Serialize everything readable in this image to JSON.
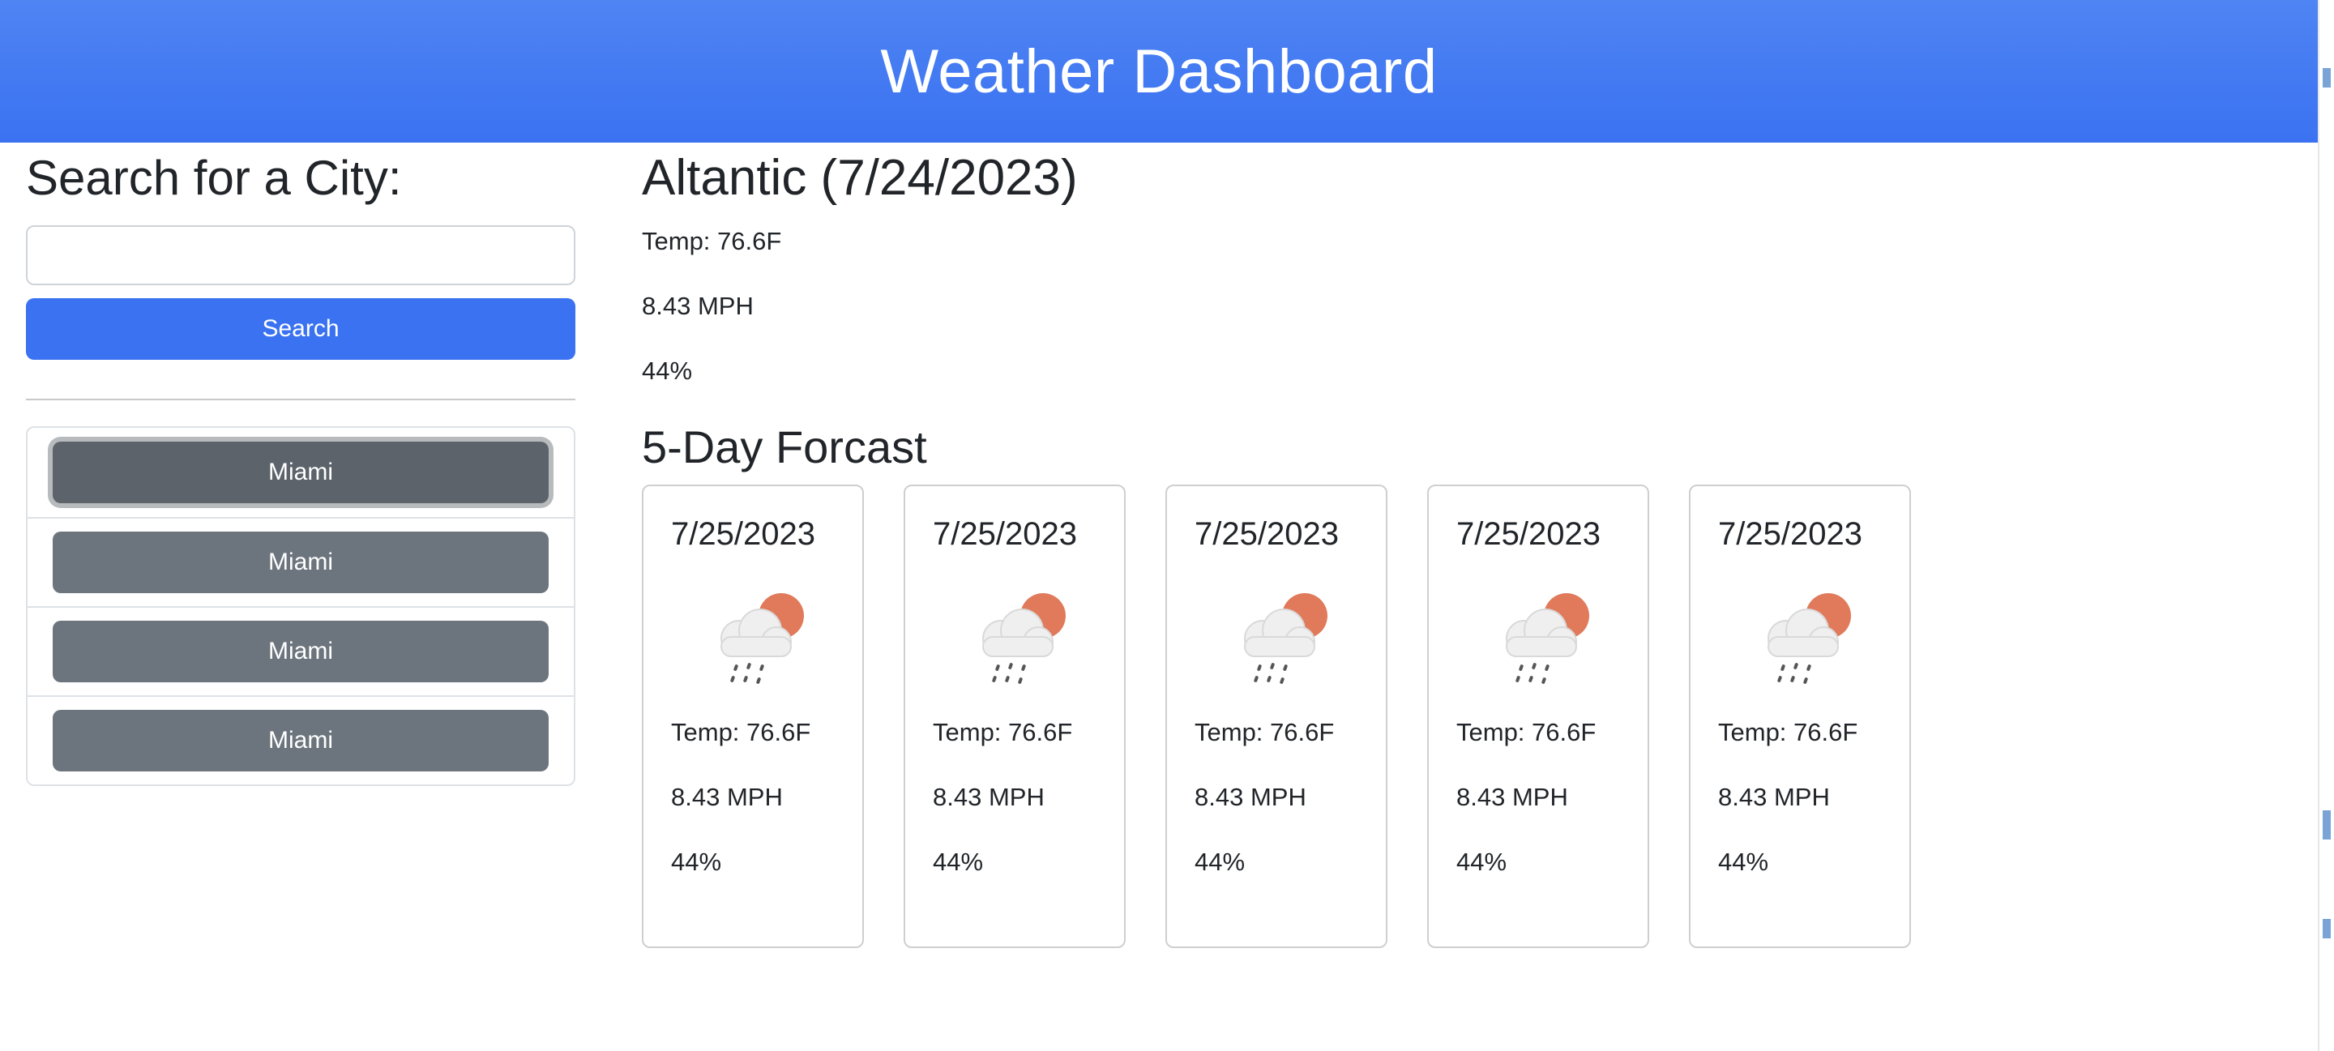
{
  "header": {
    "title": "Weather Dashboard"
  },
  "sidebar": {
    "heading": "Search for a City:",
    "search": {
      "value": "",
      "placeholder": ""
    },
    "search_button": "Search",
    "history": [
      "Miami",
      "Miami",
      "Miami",
      "Miami"
    ]
  },
  "current": {
    "title": "Altantic (7/24/2023)",
    "temp": "Temp: 76.6F",
    "wind": "8.43 MPH",
    "humidity": "44%"
  },
  "forecast": {
    "title": "5-Day Forcast",
    "icon": "cloud-rain-sun-icon",
    "days": [
      {
        "date": "7/25/2023",
        "temp": "Temp: 76.6F",
        "wind": "8.43 MPH",
        "humidity": "44%"
      },
      {
        "date": "7/25/2023",
        "temp": "Temp: 76.6F",
        "wind": "8.43 MPH",
        "humidity": "44%"
      },
      {
        "date": "7/25/2023",
        "temp": "Temp: 76.6F",
        "wind": "8.43 MPH",
        "humidity": "44%"
      },
      {
        "date": "7/25/2023",
        "temp": "Temp: 76.6F",
        "wind": "8.43 MPH",
        "humidity": "44%"
      },
      {
        "date": "7/25/2023",
        "temp": "Temp: 76.6F",
        "wind": "8.43 MPH",
        "humidity": "44%"
      }
    ]
  },
  "colors": {
    "header": "#3a72f1",
    "primary_button": "#3a72f1",
    "history_button": "#6c757d",
    "sun": "#e07a5a"
  }
}
